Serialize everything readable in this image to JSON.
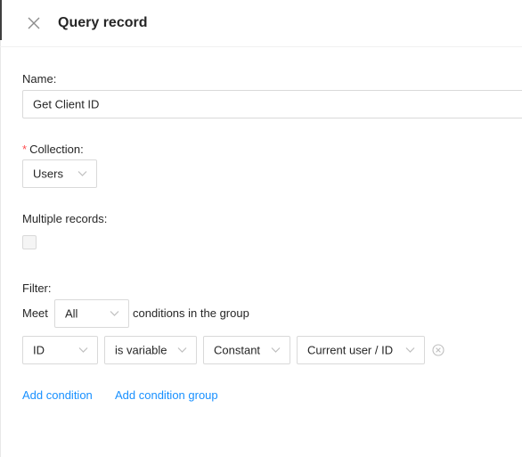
{
  "header": {
    "title": "Query record",
    "close_icon": "close-icon"
  },
  "form": {
    "name": {
      "label": "Name",
      "colon": ":",
      "value": "Get Client ID"
    },
    "collection": {
      "required_mark": "*",
      "label": "Collection",
      "colon": ":",
      "value": "Users"
    },
    "multiple_records": {
      "label": "Multiple records",
      "colon": ":",
      "checked": false
    },
    "filter": {
      "label": "Filter",
      "colon": ":",
      "meet_prefix": "Meet",
      "meet_value": "All",
      "meet_suffix": "conditions in the group",
      "condition": {
        "field": "ID",
        "operator": "is variable",
        "value_type": "Constant",
        "value": "Current user / ID",
        "remove_icon": "remove-circle-icon"
      },
      "add_condition": "Add condition",
      "add_condition_group": "Add condition group"
    }
  },
  "colors": {
    "link": "#1890ff",
    "required": "#ff4d4f",
    "border": "#d9d9d9"
  }
}
